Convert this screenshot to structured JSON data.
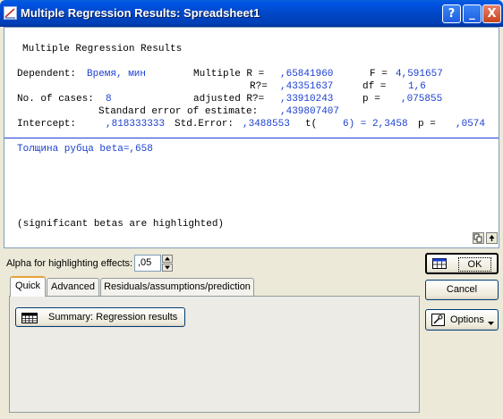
{
  "window": {
    "title": "Multiple Regression Results: Spreadsheet1",
    "help_glyph": "?",
    "min_glyph": "_",
    "close_glyph": "X"
  },
  "results": {
    "heading": "Multiple Regression Results",
    "dependent_label": "Dependent:",
    "dependent_value": "Время, мин",
    "multiple_r_label": "Multiple R =",
    "multiple_r_value": ",65841960",
    "f_label": "F =",
    "f_value": "4,591657",
    "r2_label": "R?=",
    "r2_value": ",43351637",
    "df_label": "df =",
    "df_value": "1,6",
    "cases_label": "No. of cases:",
    "cases_value": "8",
    "adj_label": "adjusted R?=",
    "adj_value": ",33910243",
    "p_label": "p =",
    "p_value": ",075855",
    "se_label": "Standard error of estimate:",
    "se_value": ",439807407",
    "intercept_label": "Intercept:",
    "intercept_value": ",818333333",
    "stderr_label": "Std.Error:",
    "stderr_value": ",3488553",
    "t_label": "t(",
    "t_value": "6) = 2,3458",
    "p2_label": "p =",
    "p2_value": ",0574",
    "beta_line": "Толщина рубца beta=,658",
    "footnote": "(significant betas are highlighted)"
  },
  "alpha": {
    "label": "Alpha for highlighting effects:",
    "value": ",05"
  },
  "tabs": [
    {
      "label": "Quick",
      "active": true
    },
    {
      "label": "Advanced",
      "active": false
    },
    {
      "label": "Residuals/assumptions/prediction",
      "active": false
    }
  ],
  "buttons": {
    "summary": "Summary:  Regression results",
    "ok": "OK",
    "cancel": "Cancel",
    "options": "Options"
  },
  "colors": {
    "title_bar": "#0047c7",
    "result_value": "#1a3fd0",
    "dialog_bg": "#ece9d8"
  },
  "icons": [
    "multiple-regression-icon",
    "copy-icon",
    "scroll-up-icon",
    "spreadsheet-icon",
    "options-icon",
    "dropdown-arrow-icon",
    "spin-up-icon",
    "spin-down-icon"
  ]
}
